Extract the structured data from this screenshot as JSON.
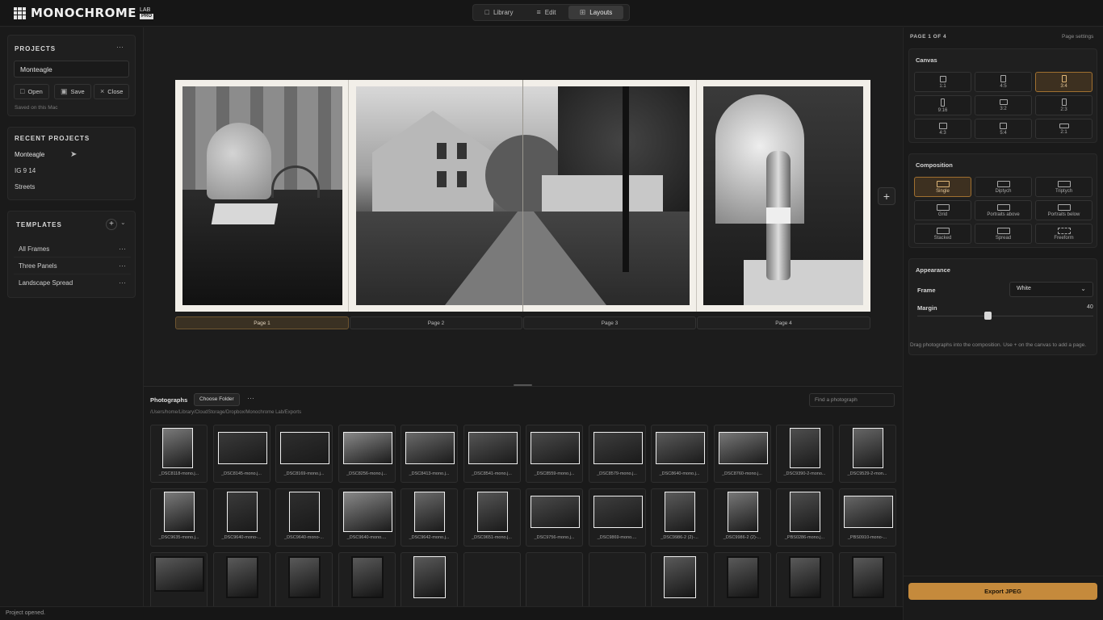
{
  "app": {
    "name": "MONOCHROME",
    "sup": "LAB",
    "badge": "PRO"
  },
  "nav": {
    "tabs": [
      {
        "label": "Library"
      },
      {
        "label": "Edit"
      },
      {
        "label": "Layouts"
      }
    ],
    "active": "Layouts"
  },
  "projects": {
    "title": "PROJECTS",
    "name_value": "Monteagle",
    "open_label": "Open",
    "save_label": "Save",
    "close_label": "Close",
    "saved_note": "Saved on this Mac"
  },
  "recent": {
    "title": "RECENT PROJECTS",
    "items": [
      "Monteagle",
      "IG 9 14",
      "Streets"
    ]
  },
  "templates": {
    "title": "TEMPLATES",
    "items": [
      "All Frames",
      "Three Panels",
      "Landscape Spread"
    ]
  },
  "pages": {
    "labels": [
      "Page 1",
      "Page 2",
      "Page 3",
      "Page 4"
    ],
    "active": "Page 1"
  },
  "right": {
    "page_indicator": "PAGE 1 OF 4",
    "page_settings": "Page settings",
    "canvas_title": "Canvas",
    "canvas_options": [
      "1:1",
      "4:5",
      "3:4",
      "9:16",
      "3:2",
      "2:3",
      "4:3",
      "5:4",
      "2:1"
    ],
    "canvas_active": "3:4",
    "composition_title": "Composition",
    "composition_options": [
      "Single",
      "Diptych",
      "Triptych",
      "Grid",
      "Portraits above",
      "Portraits below",
      "Stacked",
      "Spread",
      "Freeform"
    ],
    "composition_active": "Single",
    "appearance_title": "Appearance",
    "frame_label": "Frame",
    "frame_value": "White",
    "margin_label": "Margin",
    "margin_value": "40",
    "margin_fraction": 0.4,
    "help": "Drag photographs into the composition. Use + on the canvas to add a page.",
    "export_label": "Export JPEG"
  },
  "photos": {
    "title": "Photographs",
    "choose_folder": "Choose Folder",
    "search_placeholder": "Find a photograph",
    "path": "/Users/home/Library/CloudStorage/Dropbox/Monochrome Lab/Exports",
    "items": [
      "_DSC8118-mono.j...",
      "_DSC8145-mono.j...",
      "_DSC8169-mono.j...",
      "_DSC8256-mono.j...",
      "_DSC8413-mono.j...",
      "_DSC8541-mono.j...",
      "_DSC8559-mono.j...",
      "_DSC8579-mono.j...",
      "_DSC8640-mono.j...",
      "_DSC8760-mono.j...",
      "_DSC9390-2-mono...",
      "_DSC9529-2-mon...",
      "_DSC9635-mono.j...",
      "_DSC9640-mono-...",
      "_DSC9640-mono-...",
      "_DSC9640-mono....",
      "_DSC9642-mono.j...",
      "_DSC9651-mono.j...",
      "_DSC9756-mono.j...",
      "_DSC9869-mono....",
      "_DSC9986-2 (2)-...",
      "_DSC9986-2 (2)-...",
      "_PBS0286-mono.j...",
      "_PBS0910-mono-..."
    ]
  },
  "status": "Project opened."
}
